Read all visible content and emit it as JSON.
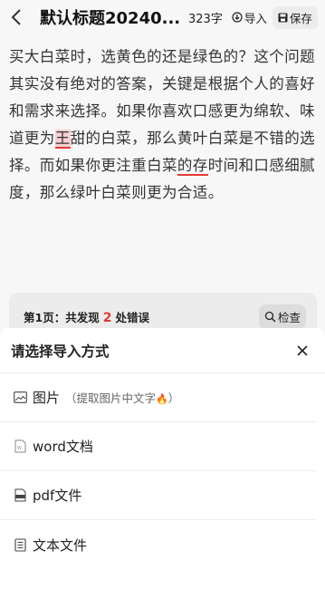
{
  "header": {
    "title": "默认标题20240...",
    "word_count": "323字",
    "import_label": "导入",
    "save_label": "保存"
  },
  "article": {
    "p1": "买大白菜时，选黄色的还是绿色的？这个问题其实没有绝对的答案，关键是根据个人的喜好和需求来选择。如果你喜欢口感更为绵软、味道更为",
    "err1": "王",
    "p2": "甜的白菜，那么黄叶白菜是不错的选择。而如果你更注重白菜",
    "err2": "的存",
    "p3": "时间和口感细腻度，那么绿叶白菜则更为合适。"
  },
  "error_bar": {
    "prefix": "第1页：共发现",
    "count": "2",
    "suffix": "处错误",
    "check_label": "检查"
  },
  "sheet": {
    "title": "请选择导入方式",
    "options": [
      {
        "label": "图片",
        "sub": "（提取图片中文字",
        "sub_end": "）",
        "icon": "image-icon"
      },
      {
        "label": "word文档",
        "icon": "word-doc-icon"
      },
      {
        "label": "pdf文件",
        "icon": "pdf-icon"
      },
      {
        "label": "文本文件",
        "icon": "text-file-icon"
      }
    ]
  },
  "colors": {
    "error_red": "#e53935",
    "highlight_pink": "#f8cfd2",
    "fire_orange": "#ff5a2a"
  }
}
